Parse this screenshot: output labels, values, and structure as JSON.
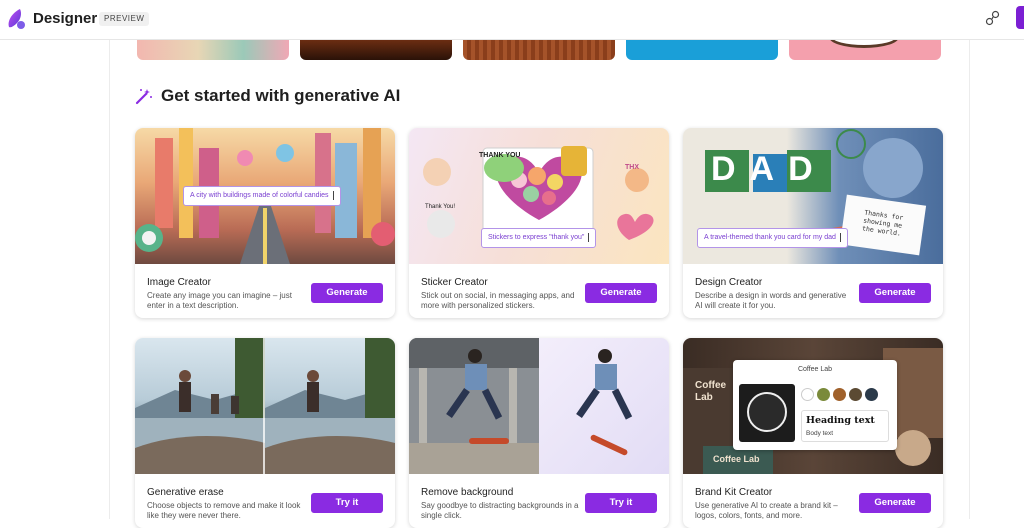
{
  "app": {
    "name": "Designer",
    "badge": "PREVIEW"
  },
  "section": {
    "title": "Get started with generative AI"
  },
  "cards": [
    {
      "title": "Image Creator",
      "description": "Create any image you can imagine – just enter in a text description.",
      "button": "Generate",
      "prompt": "A city with buildings made of colorful candies"
    },
    {
      "title": "Sticker Creator",
      "description": "Stick out on social, in messaging apps, and more with personalized stickers.",
      "button": "Generate",
      "prompt": "Stickers to express \"thank you\""
    },
    {
      "title": "Design Creator",
      "description": "Describe a design in words and generative AI will create it for you.",
      "button": "Generate",
      "prompt": "A travel-themed thank you card for my dad"
    },
    {
      "title": "Generative erase",
      "description": "Choose objects to remove and make it look like they were never there.",
      "button": "Try it"
    },
    {
      "title": "Remove background",
      "description": "Say goodbye to distracting backgrounds in a single click.",
      "button": "Try it"
    },
    {
      "title": "Brand Kit Creator",
      "description": "Use generative AI to create a brand kit – logos, colors, fonts, and more.",
      "button": "Generate"
    }
  ],
  "brand_kit_preview": {
    "name": "Coffee Lab",
    "heading": "Heading text",
    "body": "Body text",
    "logo_text": "Coffee Lab",
    "colors": [
      "#ffffff",
      "#7a8a3a",
      "#a0612b",
      "#5b4a33",
      "#2b3a4a"
    ]
  },
  "sticker_texts": {
    "thank_you": "THANK YOU",
    "thx": "THX",
    "thank_you_small": "Thank You!"
  },
  "dad_card": {
    "letters": "DAD",
    "note": "Thanks for showing me the world."
  },
  "colors": {
    "accent": "#8a2be2"
  }
}
